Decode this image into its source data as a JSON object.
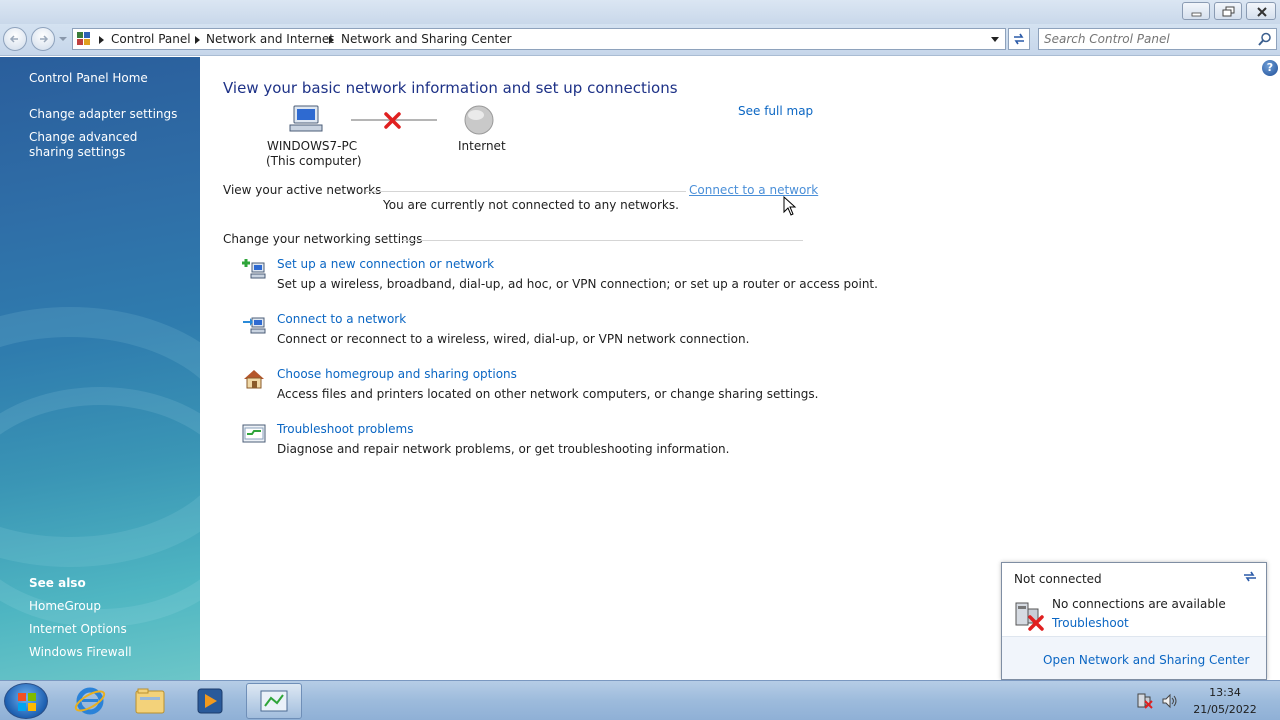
{
  "address_bar": {
    "crumbs": [
      "Control Panel",
      "Network and Internet",
      "Network and Sharing Center"
    ]
  },
  "search": {
    "placeholder": "Search Control Panel"
  },
  "sidebar": {
    "home": "Control Panel Home",
    "links": [
      "Change adapter settings",
      "Change advanced sharing settings"
    ],
    "see_also_heading": "See also",
    "see_also": [
      "HomeGroup",
      "Internet Options",
      "Windows Firewall"
    ]
  },
  "main": {
    "title": "View your basic network information and set up connections",
    "see_full_map": "See full map",
    "map": {
      "computer_name": "WINDOWS7-PC",
      "computer_sub": "(This computer)",
      "internet": "Internet"
    },
    "active_networks_label": "View your active networks",
    "connect_link": "Connect to a network",
    "not_connected_msg": "You are currently not connected to any networks.",
    "settings_label": "Change your networking settings",
    "tasks": [
      {
        "title": "Set up a new connection or network",
        "desc": "Set up a wireless, broadband, dial-up, ad hoc, or VPN connection; or set up a router or access point."
      },
      {
        "title": "Connect to a network",
        "desc": "Connect or reconnect to a wireless, wired, dial-up, or VPN network connection."
      },
      {
        "title": "Choose homegroup and sharing options",
        "desc": "Access files and printers located on other network computers, or change sharing settings."
      },
      {
        "title": "Troubleshoot problems",
        "desc": "Diagnose and repair network problems, or get troubleshooting information."
      }
    ]
  },
  "popup": {
    "title": "Not connected",
    "message": "No connections are available",
    "troubleshoot": "Troubleshoot",
    "open_center": "Open Network and Sharing Center"
  },
  "taskbar": {
    "time": "13:34",
    "date": "21/05/2022"
  },
  "colors": {
    "link": "#0b66c3",
    "title": "#1e3287",
    "error_x": "#e02020"
  }
}
